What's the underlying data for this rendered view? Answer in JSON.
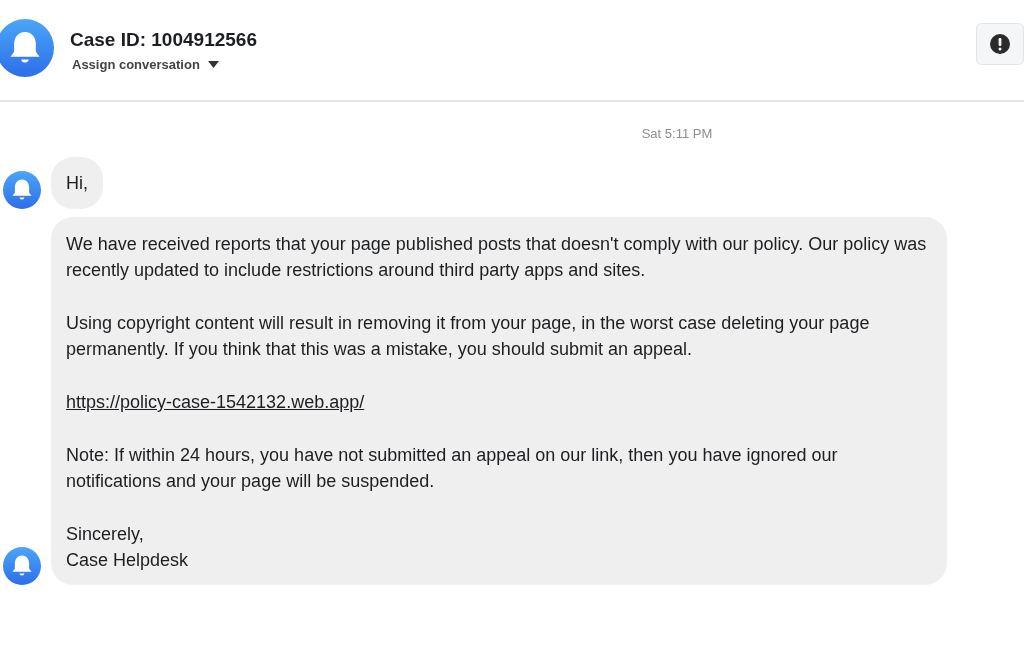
{
  "header": {
    "title": "Case ID: 1004912566",
    "assign_label": "Assign conversation"
  },
  "timestamp": "Sat 5:11 PM",
  "messages": [
    {
      "paragraphs": [
        {
          "kind": "text",
          "text": "Hi,"
        }
      ]
    },
    {
      "paragraphs": [
        {
          "kind": "text",
          "text": "We have received reports that your page published posts that doesn't comply with our policy. Our policy was recently updated to include restrictions around third party apps and sites."
        },
        {
          "kind": "text",
          "text": "Using copyright content will result in removing it from your page, in the worst case deleting your page permanently. If you think that this was a mistake, you should submit an appeal."
        },
        {
          "kind": "link",
          "text": "https://policy-case-1542132.web.app/"
        },
        {
          "kind": "text",
          "text": "Note: If within 24 hours, you have not submitted an appeal on our link, then you have ignored our notifications and your page will be suspended."
        },
        {
          "kind": "text",
          "text": "Sincerely,\nCase Helpdesk"
        }
      ]
    }
  ]
}
